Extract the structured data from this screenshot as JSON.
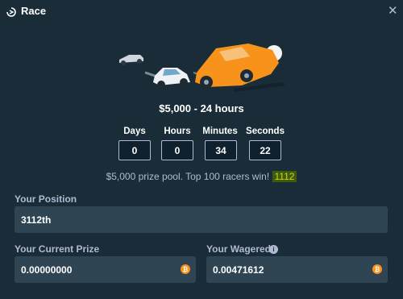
{
  "header": {
    "title": "Race"
  },
  "prize_title": "$5,000 - 24 hours",
  "countdown": [
    {
      "label": "Days",
      "value": "0"
    },
    {
      "label": "Hours",
      "value": "0"
    },
    {
      "label": "Minutes",
      "value": "34"
    },
    {
      "label": "Seconds",
      "value": "22"
    }
  ],
  "pool": {
    "text": "$5,000 prize pool. Top 100 racers win!",
    "highlight": "1112"
  },
  "position": {
    "label": "Your Position",
    "value": "3112th"
  },
  "current_prize": {
    "label": "Your Current Prize",
    "value": "0.00000000"
  },
  "wagered": {
    "label": "Your Wagered",
    "value": "0.00471612"
  },
  "icons": {
    "header": "race-icon",
    "close": "close-icon",
    "currency": "bitcoin-icon",
    "info": "info-icon"
  },
  "colors": {
    "background": "#1a2c38",
    "field": "#2f4553",
    "label": "#b1bad3",
    "bitcoin": "#f7931a",
    "highlight_text": "#d3d600"
  }
}
